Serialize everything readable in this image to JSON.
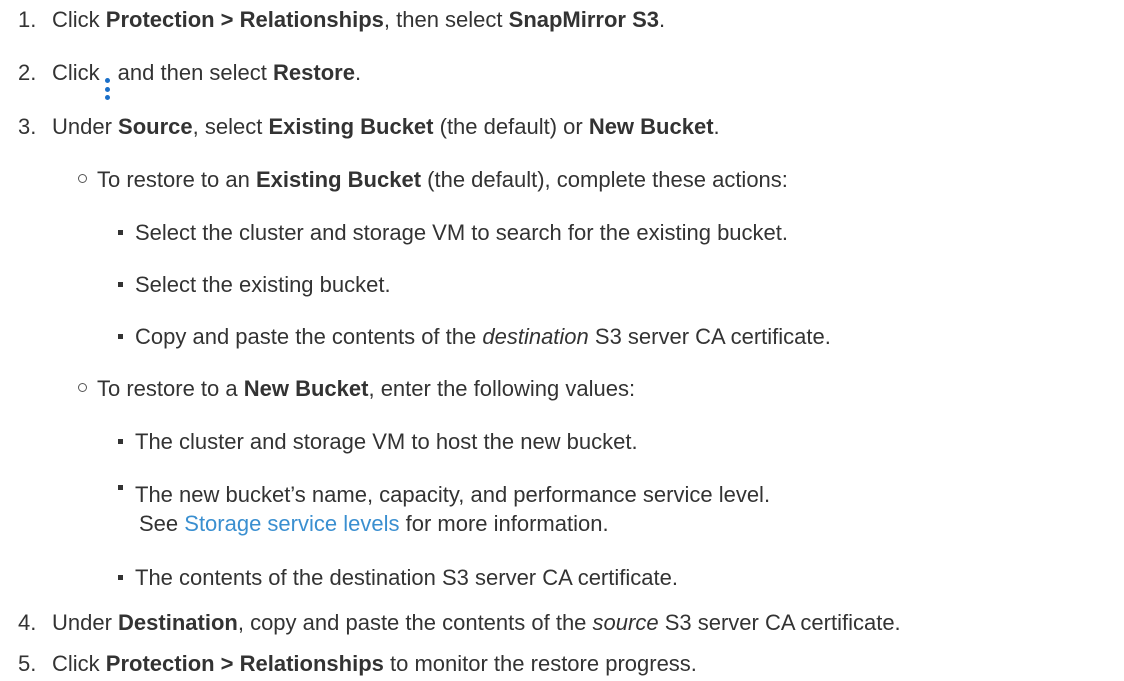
{
  "steps": [
    {
      "num": "1.",
      "t1": "Click ",
      "b1": "Protection > Relationships",
      "t2": ", then select ",
      "b2": "SnapMirror S3",
      "t3": "."
    },
    {
      "num": "2.",
      "t1": "Click",
      "icon": "kebab-menu-icon",
      "t2": "and then select ",
      "b1": "Restore",
      "t3": "."
    },
    {
      "num": "3.",
      "t1": "Under ",
      "b1": "Source",
      "t2": ", select ",
      "b2": "Existing Bucket",
      "t3": " (the default) or ",
      "b3": "New Bucket",
      "t4": "."
    },
    {
      "num": "4.",
      "t1": "Under ",
      "b1": "Destination",
      "t2": ", copy and paste the contents of the ",
      "i1": "source",
      "t3": " S3 server CA certificate."
    },
    {
      "num": "5.",
      "t1": "Click ",
      "b1": "Protection > Relationships",
      "t2": " to monitor the restore progress."
    }
  ],
  "existing": {
    "t1": "To restore to an ",
    "b1": "Existing Bucket",
    "t2": " (the default), complete these actions:",
    "items": [
      "Select the cluster and storage VM to search for the existing bucket.",
      "Select the existing bucket."
    ],
    "copy": {
      "t1": "Copy and paste the contents of the ",
      "i1": "destination",
      "t2": " S3 server CA certificate."
    }
  },
  "newbucket": {
    "t1": "To restore to a ",
    "b1": "New Bucket",
    "t2": ", enter the following values:",
    "item1": "The cluster and storage VM to host the new bucket.",
    "item2": "The new bucket’s name, capacity, and performance service level.",
    "see_prefix": "See ",
    "link": "Storage service levels",
    "see_suffix": " for more information.",
    "item3": "The contents of the destination S3 server CA certificate."
  },
  "colors": {
    "text": "#333333",
    "link": "#3a8fd0",
    "icon": "#1a6fc9"
  }
}
